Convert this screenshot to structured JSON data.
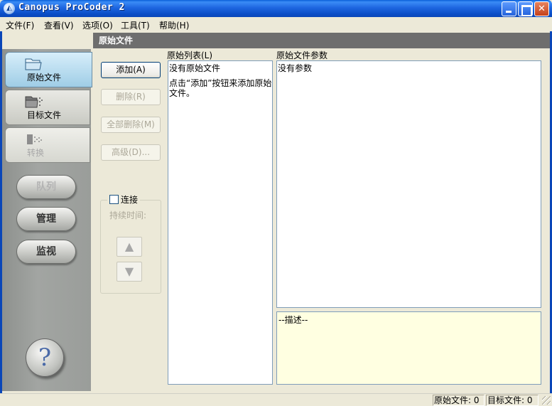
{
  "window": {
    "title": "Canopus ProCoder 2",
    "icon_glyph": "◭"
  },
  "menu": [
    {
      "label": "文件(F)"
    },
    {
      "label": "查看(V)"
    },
    {
      "label": "选项(O)"
    },
    {
      "label": "工具(T)"
    },
    {
      "label": "帮助(H)"
    }
  ],
  "sidebar": {
    "tabs": [
      {
        "label": "原始文件",
        "state": "active",
        "icon": "folder-icon"
      },
      {
        "label": "目标文件",
        "state": "normal",
        "icon": "target-folder-icon"
      },
      {
        "label": "转换",
        "state": "disabled",
        "icon": "convert-icon"
      }
    ],
    "buttons": [
      {
        "label": "队列",
        "state": "disabled"
      },
      {
        "label": "管理",
        "state": "normal"
      },
      {
        "label": "监视",
        "state": "normal"
      }
    ],
    "help_glyph": "?"
  },
  "header": {
    "title": "原始文件"
  },
  "actions": {
    "add": "添加(A)",
    "delete": "删除(R)",
    "delete_all": "全部删除(M)",
    "advanced": "高级(D)..."
  },
  "concat": {
    "checkbox_label": "连接",
    "checked": false,
    "duration_label": "持续时间:",
    "up_glyph": "▲",
    "down_glyph": "▼"
  },
  "source_list": {
    "label": "原始列表(L)",
    "empty_text": "没有原始文件",
    "hint_text": "点击“添加”按钮来添加原始文件。"
  },
  "params": {
    "label": "原始文件参数",
    "empty_text": "没有参数"
  },
  "description": {
    "text": "--描述--"
  },
  "status": {
    "source_count": "原始文件: 0",
    "target_count": "目标文件: 0"
  },
  "colors": {
    "titlebar": "#0A5FD8",
    "header_strip": "#6E6E6E",
    "description_bg": "#FFFFE1",
    "window_bg": "#ECE9D8"
  }
}
